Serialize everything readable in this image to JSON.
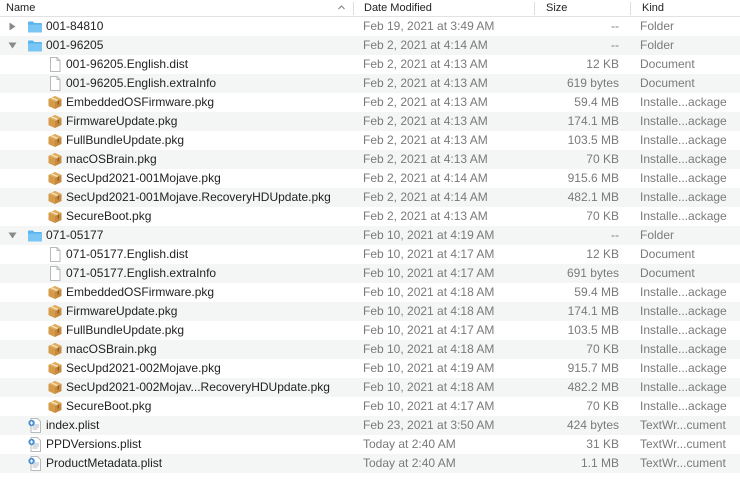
{
  "columns": {
    "name": "Name",
    "date": "Date Modified",
    "size": "Size",
    "kind": "Kind"
  },
  "rows": [
    {
      "name": "001-84810",
      "date": "Feb 19, 2021 at 3:49 AM",
      "size": "--",
      "kind": "Folder",
      "type": "folder",
      "level": 0,
      "expanded": false
    },
    {
      "name": "001-96205",
      "date": "Feb 2, 2021 at 4:14 AM",
      "size": "--",
      "kind": "Folder",
      "type": "folder",
      "level": 0,
      "expanded": true
    },
    {
      "name": "001-96205.English.dist",
      "date": "Feb 2, 2021 at 4:13 AM",
      "size": "12 KB",
      "kind": "Document",
      "type": "doc",
      "level": 1
    },
    {
      "name": "001-96205.English.extraInfo",
      "date": "Feb 2, 2021 at 4:13 AM",
      "size": "619 bytes",
      "kind": "Document",
      "type": "doc",
      "level": 1
    },
    {
      "name": "EmbeddedOSFirmware.pkg",
      "date": "Feb 2, 2021 at 4:13 AM",
      "size": "59.4 MB",
      "kind": "Installe...ackage",
      "type": "pkg",
      "level": 1
    },
    {
      "name": "FirmwareUpdate.pkg",
      "date": "Feb 2, 2021 at 4:13 AM",
      "size": "174.1 MB",
      "kind": "Installe...ackage",
      "type": "pkg",
      "level": 1
    },
    {
      "name": "FullBundleUpdate.pkg",
      "date": "Feb 2, 2021 at 4:13 AM",
      "size": "103.5 MB",
      "kind": "Installe...ackage",
      "type": "pkg",
      "level": 1
    },
    {
      "name": "macOSBrain.pkg",
      "date": "Feb 2, 2021 at 4:13 AM",
      "size": "70 KB",
      "kind": "Installe...ackage",
      "type": "pkg",
      "level": 1
    },
    {
      "name": "SecUpd2021-001Mojave.pkg",
      "date": "Feb 2, 2021 at 4:14 AM",
      "size": "915.6 MB",
      "kind": "Installe...ackage",
      "type": "pkg",
      "level": 1
    },
    {
      "name": "SecUpd2021-001Mojave.RecoveryHDUpdate.pkg",
      "date": "Feb 2, 2021 at 4:14 AM",
      "size": "482.1 MB",
      "kind": "Installe...ackage",
      "type": "pkg",
      "level": 1
    },
    {
      "name": "SecureBoot.pkg",
      "date": "Feb 2, 2021 at 4:13 AM",
      "size": "70 KB",
      "kind": "Installe...ackage",
      "type": "pkg",
      "level": 1
    },
    {
      "name": "071-05177",
      "date": "Feb 10, 2021 at 4:19 AM",
      "size": "--",
      "kind": "Folder",
      "type": "folder",
      "level": 0,
      "expanded": true
    },
    {
      "name": "071-05177.English.dist",
      "date": "Feb 10, 2021 at 4:17 AM",
      "size": "12 KB",
      "kind": "Document",
      "type": "doc",
      "level": 1
    },
    {
      "name": "071-05177.English.extraInfo",
      "date": "Feb 10, 2021 at 4:17 AM",
      "size": "691 bytes",
      "kind": "Document",
      "type": "doc",
      "level": 1
    },
    {
      "name": "EmbeddedOSFirmware.pkg",
      "date": "Feb 10, 2021 at 4:18 AM",
      "size": "59.4 MB",
      "kind": "Installe...ackage",
      "type": "pkg",
      "level": 1
    },
    {
      "name": "FirmwareUpdate.pkg",
      "date": "Feb 10, 2021 at 4:18 AM",
      "size": "174.1 MB",
      "kind": "Installe...ackage",
      "type": "pkg",
      "level": 1
    },
    {
      "name": "FullBundleUpdate.pkg",
      "date": "Feb 10, 2021 at 4:17 AM",
      "size": "103.5 MB",
      "kind": "Installe...ackage",
      "type": "pkg",
      "level": 1
    },
    {
      "name": "macOSBrain.pkg",
      "date": "Feb 10, 2021 at 4:18 AM",
      "size": "70 KB",
      "kind": "Installe...ackage",
      "type": "pkg",
      "level": 1
    },
    {
      "name": "SecUpd2021-002Mojave.pkg",
      "date": "Feb 10, 2021 at 4:19 AM",
      "size": "915.7 MB",
      "kind": "Installe...ackage",
      "type": "pkg",
      "level": 1
    },
    {
      "name": "SecUpd2021-002Mojav...RecoveryHDUpdate.pkg",
      "date": "Feb 10, 2021 at 4:18 AM",
      "size": "482.2 MB",
      "kind": "Installe...ackage",
      "type": "pkg",
      "level": 1
    },
    {
      "name": "SecureBoot.pkg",
      "date": "Feb 10, 2021 at 4:17 AM",
      "size": "70 KB",
      "kind": "Installe...ackage",
      "type": "pkg",
      "level": 1
    },
    {
      "name": "index.plist",
      "date": "Feb 23, 2021 at 3:50 AM",
      "size": "424 bytes",
      "kind": "TextWr...cument",
      "type": "plist",
      "level": 0
    },
    {
      "name": "PPDVersions.plist",
      "date": "Today at 2:40 AM",
      "size": "31 KB",
      "kind": "TextWr...cument",
      "type": "plist",
      "level": 0
    },
    {
      "name": "ProductMetadata.plist",
      "date": "Today at 2:40 AM",
      "size": "1.1 MB",
      "kind": "TextWr...cument",
      "type": "plist",
      "level": 0
    }
  ]
}
